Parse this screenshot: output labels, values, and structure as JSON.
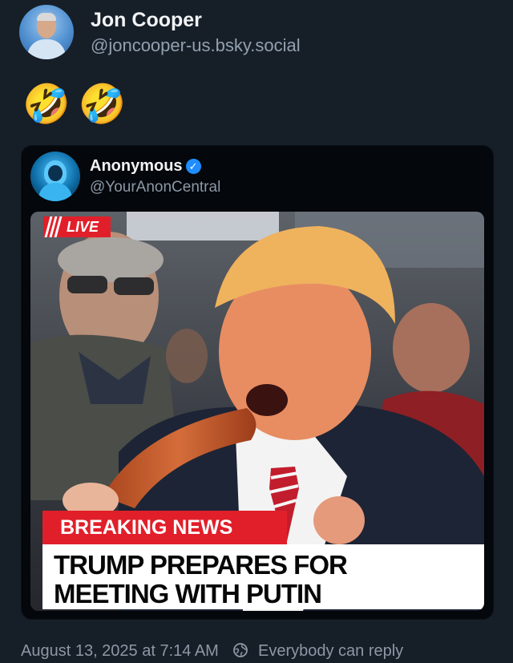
{
  "post": {
    "author_name": "Jon Cooper",
    "author_handle": "@joncooper-us.bsky.social",
    "text": "🤣🤣"
  },
  "quote": {
    "author_name": "Anonymous",
    "author_handle": "@YourAnonCentral",
    "verified_icon": "verified-checkmark-icon",
    "media": {
      "live_label": "LIVE",
      "banner": "BREAKING NEWS",
      "headline_line1": "TRUMP PREPARES FOR",
      "headline_line2": "MEETING WITH PUTIN"
    }
  },
  "footer": {
    "timestamp": "August 13, 2025 at 7:14 AM",
    "reply_setting": "Everybody can reply",
    "reply_icon": "globe-reply-icon"
  },
  "colors": {
    "background": "#161e27",
    "card_background": "#04070b",
    "breaking_red": "#e11f2a",
    "verified_blue": "#1f8dff"
  }
}
